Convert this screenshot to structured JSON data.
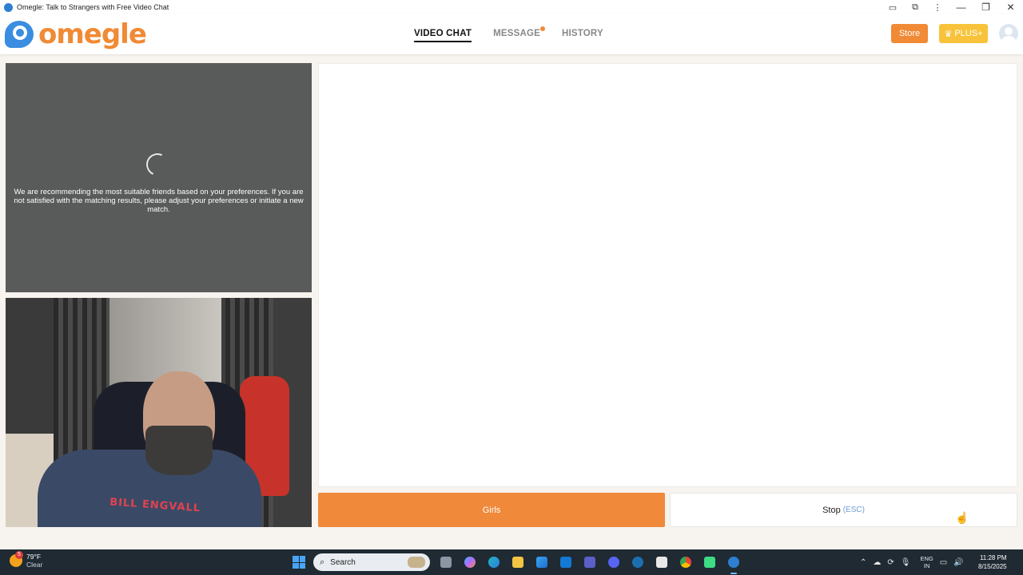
{
  "window": {
    "title": "Omegle: Talk to Strangers with Free Video Chat"
  },
  "header": {
    "logo_text": "omegle",
    "nav": [
      {
        "label": "VIDEO CHAT",
        "active": true
      },
      {
        "label": "MESSAGE",
        "active": false,
        "has_notification_dot": true
      },
      {
        "label": "HISTORY",
        "active": false
      }
    ],
    "store_label": "Store",
    "plus_label": "PLUS+"
  },
  "stranger_panel": {
    "message": "We are recommending the most suitable friends based on your preferences. If you are not satisfied with the matching results, please adjust your preferences or initiate a new match."
  },
  "self_panel": {
    "shirt_text": "BILL ENGVALL"
  },
  "actions": {
    "girls_label": "Girls",
    "stop_label": "Stop",
    "stop_hint": "(ESC)"
  },
  "taskbar": {
    "weather_temp": "79°F",
    "weather_condition": "Clear",
    "weather_badge": "5",
    "search_label": "Search",
    "lang_top": "ENG",
    "lang_bottom": "IN",
    "time": "11:28 PM",
    "date": "8/15/2025"
  },
  "colors": {
    "accent_orange": "#f0893a",
    "plus_yellow": "#f8c33a",
    "panel_gray": "#595a5a",
    "taskbar": "#1f2a33"
  }
}
